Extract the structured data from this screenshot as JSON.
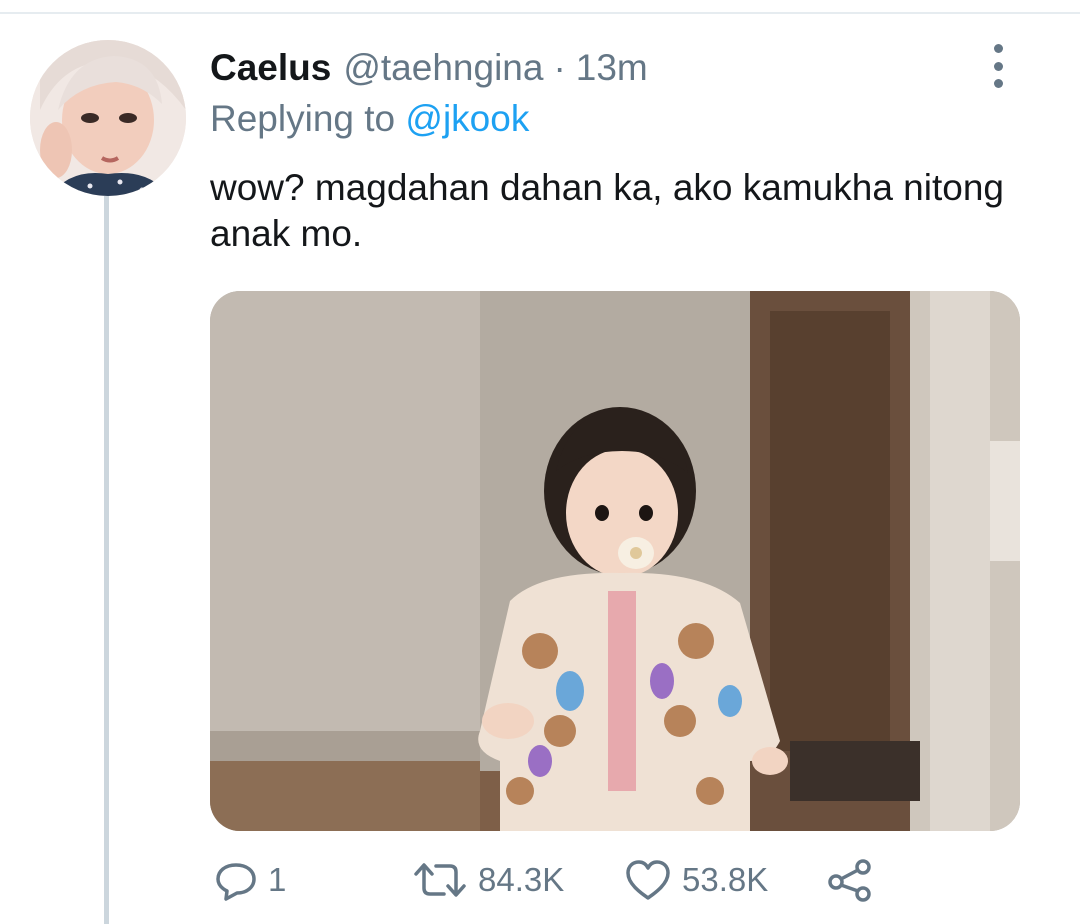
{
  "tweet": {
    "display_name": "Caelus",
    "handle": "@taehngina",
    "separator": "·",
    "time": "13m",
    "replying_prefix": "Replying to",
    "replying_to": "@jkook",
    "text": "wow? magdahan dahan ka, ako kamukha nitong anak mo."
  },
  "actions": {
    "reply_count": "1",
    "retweet_count": "84.3K",
    "like_count": "53.8K"
  },
  "icons": {
    "reply": "reply-icon",
    "retweet": "retweet-icon",
    "like": "heart-icon",
    "share": "share-icon",
    "more": "more-vertical-icon"
  },
  "colors": {
    "text": "#14171a",
    "secondary": "#657786",
    "link": "#1da1f2",
    "thread_line": "#ccd6dd"
  }
}
